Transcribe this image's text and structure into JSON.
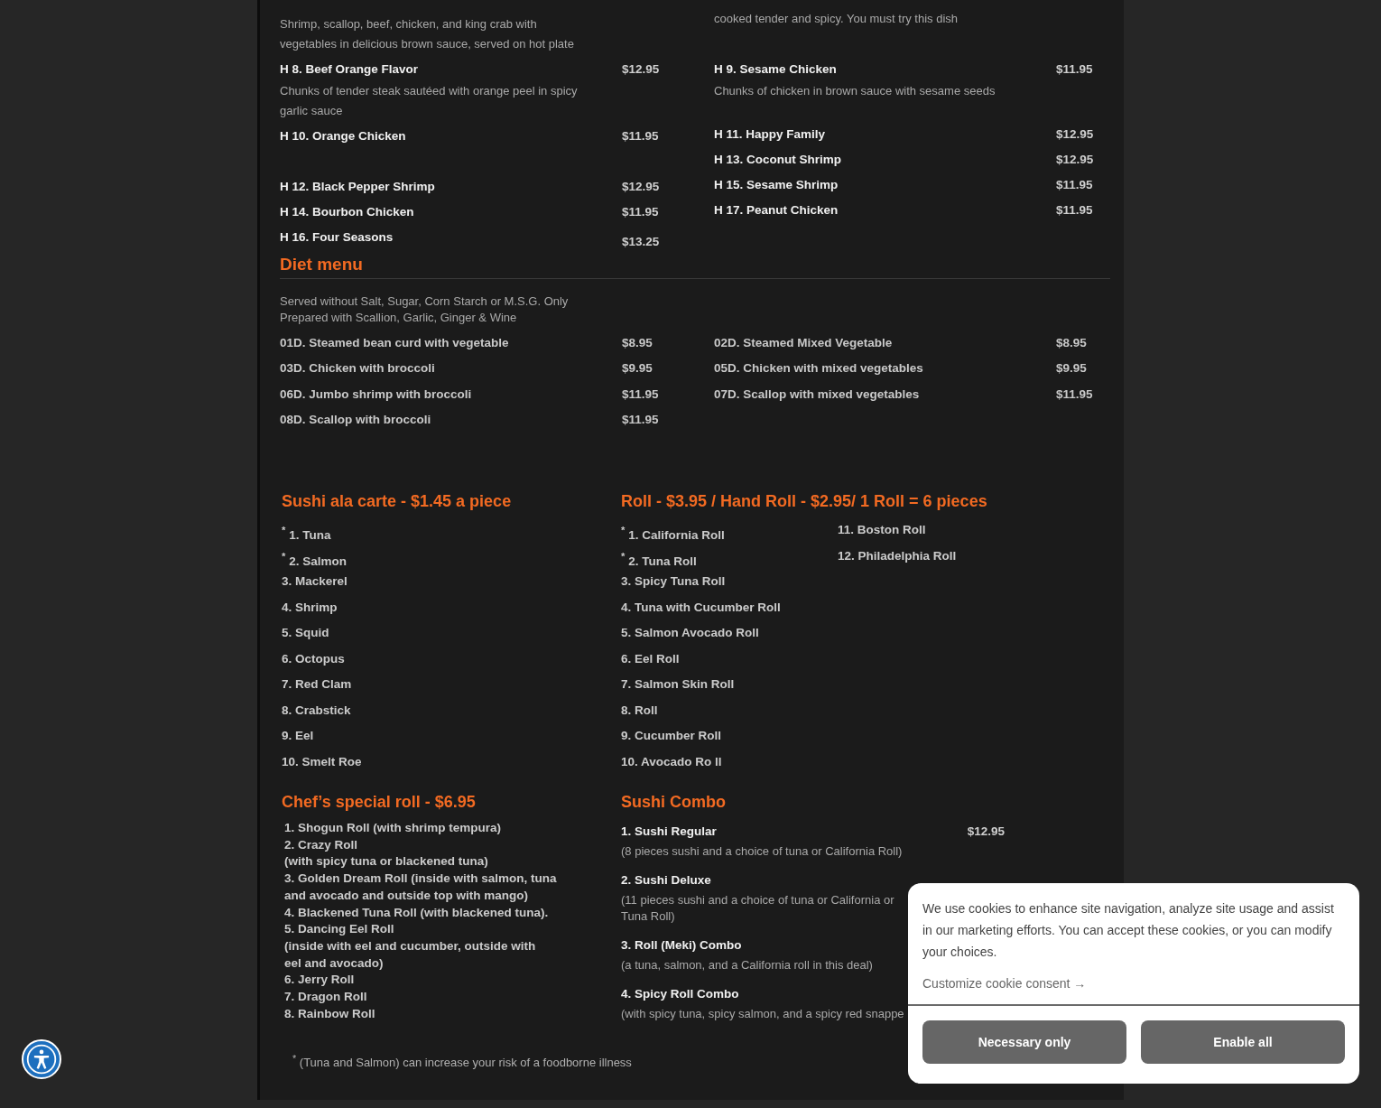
{
  "hot_dishes": {
    "columns": [
      [
        {
          "description": "Shrimp, scallop, beef, chicken, and king crab with vegetables in delicious brown sauce, served on hot plate"
        },
        {
          "name": "H 8. Beef Orange Flavor",
          "price": "$12.95",
          "description": "Chunks of tender steak sautéed with orange peel in spicy garlic sauce"
        },
        {
          "name": "H 10. Orange Chicken",
          "price": "$11.95"
        },
        {
          "name": "H 12. Black Pepper Shrimp",
          "price": "$12.95"
        },
        {
          "name": "H 14. Bourbon Chicken",
          "price": "$11.95"
        },
        {
          "name": "H 16. Four Seasons",
          "price": "$13.25"
        }
      ],
      [
        {
          "description": "cooked tender and spicy. You must try this dish"
        },
        {
          "name": "H 9. Sesame Chicken",
          "price": "$11.95",
          "description": "Chunks of chicken in brown sauce with sesame seeds"
        },
        {
          "name": "H 11. Happy Family",
          "price": "$12.95"
        },
        {
          "name": "H 13. Coconut Shrimp",
          "price": "$12.95"
        },
        {
          "name": "H 15. Sesame Shrimp",
          "price": "$11.95"
        },
        {
          "name": "H 17. Peanut Chicken",
          "price": "$11.95"
        }
      ]
    ]
  },
  "diet_menu": {
    "title": "Diet menu",
    "note_lines": [
      "Served without Salt, Sugar, Corn Starch or M.S.G. Only",
      "Prepared with Scallion, Garlic, Ginger & Wine"
    ],
    "items": [
      {
        "name": "01D. Steamed bean curd with vegetable",
        "price": "$8.95"
      },
      {
        "name": "02D. Steamed Mixed Vegetable",
        "price": "$8.95"
      },
      {
        "name": "03D. Chicken with broccoli",
        "price": "$9.95"
      },
      {
        "name": "05D. Chicken with mixed vegetables",
        "price": "$9.95"
      },
      {
        "name": "06D. Jumbo shrimp with broccoli",
        "price": "$11.95"
      },
      {
        "name": "07D. Scallop with mixed vegetables",
        "price": "$11.95"
      },
      {
        "name": "08D. Scallop with broccoli",
        "price": "$11.95"
      }
    ]
  },
  "sushi_ala_carte": {
    "title": "Sushi ala carte - $1.45 a piece",
    "items": [
      "$^{*}$ 1. Tuna",
      "$^{*}$ 2. Salmon",
      "3. Mackerel",
      "4. Shrimp",
      "5. Squid",
      "6. Octopus",
      "7. Red Clam",
      "8. Crabstick",
      "9. Eel",
      "10. Smelt Roe"
    ]
  },
  "chefs_special_roll": {
    "title": "Chef’s special roll - $6.95",
    "lines": [
      "1. Shogun Roll (with shrimp tempura)",
      "2. Crazy Roll",
      "(with spicy tuna or blackened tuna)",
      "3. Golden Dream Roll (inside with salmon, tuna",
      "and avocado and outside top with mango)",
      "4. Blackened Tuna Roll (with blackened tuna).",
      "5. Dancing Eel Roll",
      "(inside with eel and cucumber, outside with",
      "eel and avocado)",
      "6. Jerry Roll",
      "7. Dragon Roll",
      "8. Rainbow Roll"
    ]
  },
  "rolls": {
    "title": "Roll - $3.95 / Hand Roll - $2.95/ 1 Roll = 6 pieces",
    "columns": [
      [
        "$^{*}$ 1. California Roll",
        "$^{*}$ 2. Tuna Roll",
        "3. Spicy Tuna Roll",
        "4. Tuna with Cucumber Roll",
        "5. Salmon Avocado Roll",
        "6. Eel Roll",
        "7. Salmon Skin Roll",
        "8. Roll",
        "9. Cucumber Roll",
        "10. Avocado Ro ll"
      ],
      [
        "11. Boston Roll",
        "12. Philadelphia Roll"
      ]
    ]
  },
  "sushi_combo": {
    "title": "Sushi Combo",
    "items": [
      {
        "name": "1. Sushi Regular",
        "price": "$12.95",
        "description": "(8 pieces sushi and a choice of tuna or California Roll)"
      },
      {
        "name": "2. Sushi Deluxe",
        "description": "(11 pieces sushi and a choice of tuna or California or Tuna Roll)"
      },
      {
        "name": "3. Roll (Meki) Combo",
        "description": "(a tuna, salmon, and a California roll in this deal)"
      },
      {
        "name": "4. Spicy Roll Combo",
        "description": "(with spicy tuna, spicy salmon, and a spicy red snappe"
      }
    ]
  },
  "footnote": "$^{*}$ (Tuna and Salmon) can increase your risk of a foodborne illness",
  "cookie_banner": {
    "message": "We use cookies to enhance site navigation, analyze site usage and assist in our marketing efforts. You can accept these cookies, or you can modify your choices.",
    "customize_link": "Customize cookie consent →",
    "buttons": [
      "Necessary only",
      "Enable all"
    ]
  }
}
